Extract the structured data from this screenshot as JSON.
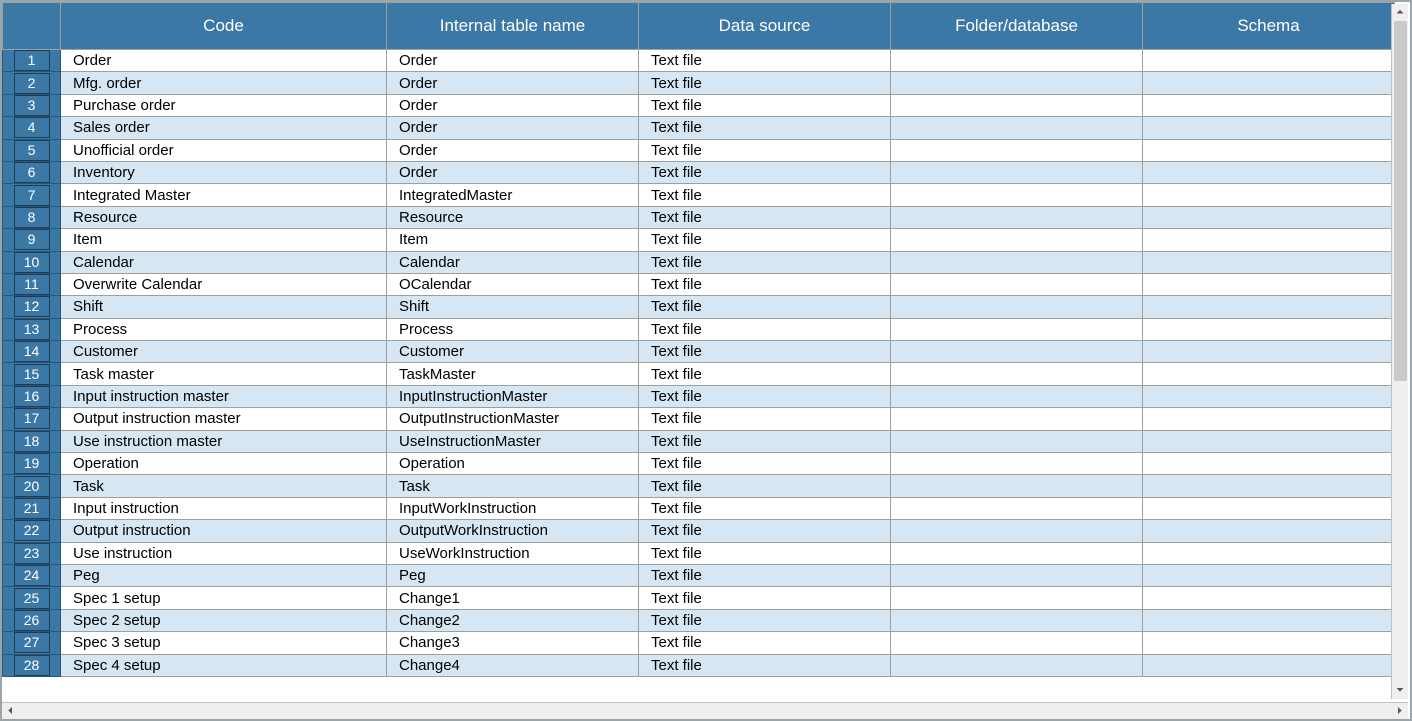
{
  "headers": [
    "",
    "Code",
    "Internal table name",
    "Data source",
    "Folder/database",
    "Schema"
  ],
  "rows": [
    {
      "num": "1",
      "code": "Order",
      "internal": "Order",
      "source": "Text file",
      "folder": "",
      "schema": ""
    },
    {
      "num": "2",
      "code": "Mfg. order",
      "internal": "Order",
      "source": "Text file",
      "folder": "",
      "schema": ""
    },
    {
      "num": "3",
      "code": "Purchase order",
      "internal": "Order",
      "source": "Text file",
      "folder": "",
      "schema": ""
    },
    {
      "num": "4",
      "code": "Sales order",
      "internal": "Order",
      "source": "Text file",
      "folder": "",
      "schema": ""
    },
    {
      "num": "5",
      "code": "Unofficial order",
      "internal": "Order",
      "source": "Text file",
      "folder": "",
      "schema": ""
    },
    {
      "num": "6",
      "code": "Inventory",
      "internal": "Order",
      "source": "Text file",
      "folder": "",
      "schema": ""
    },
    {
      "num": "7",
      "code": "Integrated Master",
      "internal": "IntegratedMaster",
      "source": "Text file",
      "folder": "",
      "schema": ""
    },
    {
      "num": "8",
      "code": "Resource",
      "internal": "Resource",
      "source": "Text file",
      "folder": "",
      "schema": ""
    },
    {
      "num": "9",
      "code": "Item",
      "internal": "Item",
      "source": "Text file",
      "folder": "",
      "schema": ""
    },
    {
      "num": "10",
      "code": "Calendar",
      "internal": "Calendar",
      "source": "Text file",
      "folder": "",
      "schema": ""
    },
    {
      "num": "11",
      "code": "Overwrite Calendar",
      "internal": "OCalendar",
      "source": "Text file",
      "folder": "",
      "schema": ""
    },
    {
      "num": "12",
      "code": "Shift",
      "internal": "Shift",
      "source": "Text file",
      "folder": "",
      "schema": ""
    },
    {
      "num": "13",
      "code": "Process",
      "internal": "Process",
      "source": "Text file",
      "folder": "",
      "schema": ""
    },
    {
      "num": "14",
      "code": "Customer",
      "internal": "Customer",
      "source": "Text file",
      "folder": "",
      "schema": ""
    },
    {
      "num": "15",
      "code": "Task master",
      "internal": "TaskMaster",
      "source": "Text file",
      "folder": "",
      "schema": ""
    },
    {
      "num": "16",
      "code": "Input instruction master",
      "internal": "InputInstructionMaster",
      "source": "Text file",
      "folder": "",
      "schema": ""
    },
    {
      "num": "17",
      "code": "Output instruction master",
      "internal": "OutputInstructionMaster",
      "source": "Text file",
      "folder": "",
      "schema": ""
    },
    {
      "num": "18",
      "code": "Use instruction master",
      "internal": "UseInstructionMaster",
      "source": "Text file",
      "folder": "",
      "schema": ""
    },
    {
      "num": "19",
      "code": "Operation",
      "internal": "Operation",
      "source": "Text file",
      "folder": "",
      "schema": ""
    },
    {
      "num": "20",
      "code": "Task",
      "internal": "Task",
      "source": "Text file",
      "folder": "",
      "schema": ""
    },
    {
      "num": "21",
      "code": "Input instruction",
      "internal": "InputWorkInstruction",
      "source": "Text file",
      "folder": "",
      "schema": ""
    },
    {
      "num": "22",
      "code": "Output instruction",
      "internal": "OutputWorkInstruction",
      "source": "Text file",
      "folder": "",
      "schema": ""
    },
    {
      "num": "23",
      "code": "Use instruction",
      "internal": "UseWorkInstruction",
      "source": "Text file",
      "folder": "",
      "schema": ""
    },
    {
      "num": "24",
      "code": "Peg",
      "internal": "Peg",
      "source": "Text file",
      "folder": "",
      "schema": ""
    },
    {
      "num": "25",
      "code": "Spec 1 setup",
      "internal": "Change1",
      "source": "Text file",
      "folder": "",
      "schema": ""
    },
    {
      "num": "26",
      "code": "Spec 2 setup",
      "internal": "Change2",
      "source": "Text file",
      "folder": "",
      "schema": ""
    },
    {
      "num": "27",
      "code": "Spec 3 setup",
      "internal": "Change3",
      "source": "Text file",
      "folder": "",
      "schema": ""
    },
    {
      "num": "28",
      "code": "Spec 4 setup",
      "internal": "Change4",
      "source": "Text file",
      "folder": "",
      "schema": ""
    }
  ],
  "scroll": {
    "up": "⏶",
    "down": "⏷",
    "left": "⏴",
    "right": "⏵"
  }
}
